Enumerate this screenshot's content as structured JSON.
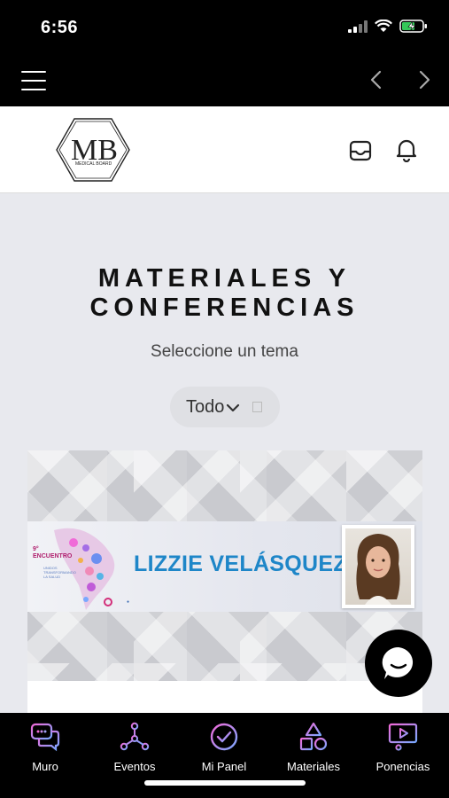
{
  "status_bar": {
    "time": "6:56"
  },
  "header": {
    "logo_initials": "MB",
    "logo_text": "MEDICAL BOARD"
  },
  "main": {
    "title": "MATERIALES Y CONFERENCIAS",
    "subtitle": "Seleccione un tema",
    "filter": {
      "selected": "Todo"
    }
  },
  "card": {
    "speaker_name": "LIZZIE VELÁSQUEZ",
    "event_title": "9° ENCUENTRO",
    "event_subtitle": "UNIDOS TRANSFORMANDO LA SALUD"
  },
  "tabs": [
    {
      "label": "Muro",
      "icon": "chat-bubble-icon"
    },
    {
      "label": "Eventos",
      "icon": "network-icon"
    },
    {
      "label": "Mi Panel",
      "icon": "check-circle-icon"
    },
    {
      "label": "Materiales",
      "icon": "shapes-icon"
    },
    {
      "label": "Ponencias",
      "icon": "video-play-icon"
    }
  ],
  "colors": {
    "accent_gradient_start": "#f06ad8",
    "accent_gradient_end": "#7aa8ff",
    "speaker_name": "#1e86c8",
    "background": "#e8e9ee"
  }
}
